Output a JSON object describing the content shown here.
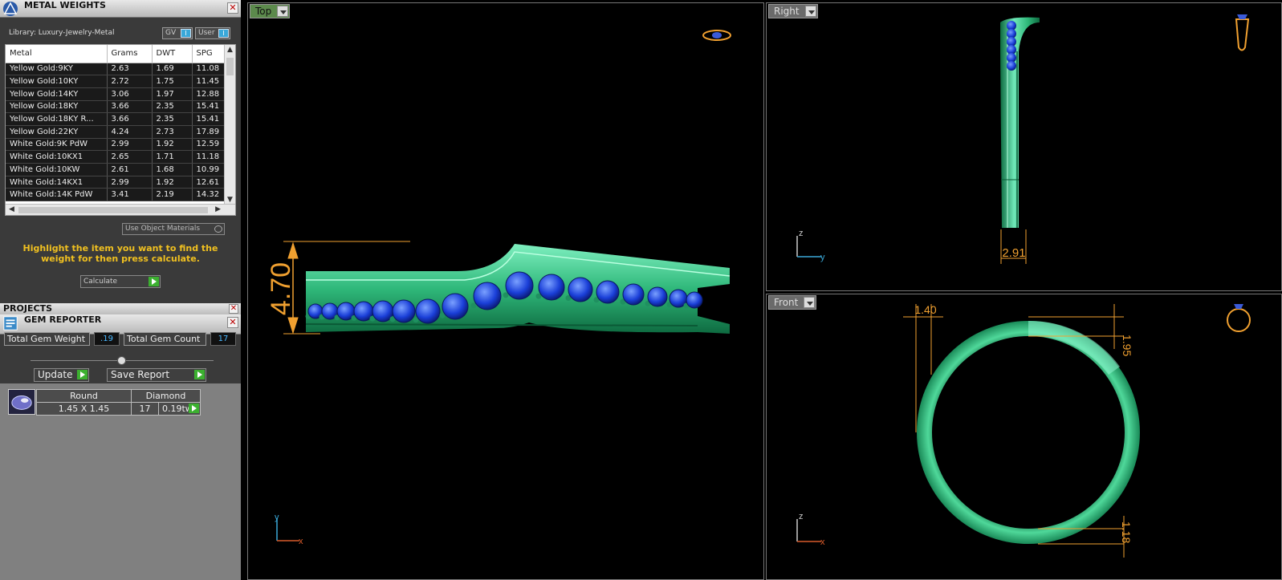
{
  "metal_weights": {
    "title": "METAL WEIGHTS",
    "library": "Library: Luxury-Jewelry-Metal",
    "toggle_gv": "GV",
    "toggle_user": "User",
    "columns": [
      "Metal",
      "Grams",
      "DWT",
      "SPG"
    ],
    "rows": [
      [
        "Yellow Gold:9KY",
        "2.63",
        "1.69",
        "11.08"
      ],
      [
        "Yellow Gold:10KY",
        "2.72",
        "1.75",
        "11.45"
      ],
      [
        "Yellow Gold:14KY",
        "3.06",
        "1.97",
        "12.88"
      ],
      [
        "Yellow Gold:18KY",
        "3.66",
        "2.35",
        "15.41"
      ],
      [
        "Yellow Gold:18KY R...",
        "3.66",
        "2.35",
        "15.41"
      ],
      [
        "Yellow Gold:22KY",
        "4.24",
        "2.73",
        "17.89"
      ],
      [
        "White Gold:9K PdW",
        "2.99",
        "1.92",
        "12.59"
      ],
      [
        "White Gold:10KX1",
        "2.65",
        "1.71",
        "11.18"
      ],
      [
        "White Gold:10KW",
        "2.61",
        "1.68",
        "10.99"
      ],
      [
        "White Gold:14KX1",
        "2.99",
        "1.92",
        "12.61"
      ],
      [
        "White Gold:14K PdW",
        "3.41",
        "2.19",
        "14.32"
      ]
    ],
    "use_object_materials": "Use Object Materials",
    "hint": "Highlight the item you want to find the weight for then press calculate.",
    "calculate": "Calculate"
  },
  "projects": {
    "title": "PROJECTS"
  },
  "gem_reporter": {
    "title": "GEM REPORTER",
    "total_weight_label": "Total Gem Weight",
    "total_weight_value": ".19",
    "total_count_label": "Total Gem Count",
    "total_count_value": "17",
    "update": "Update",
    "save_report": "Save Report",
    "gem": {
      "shape": "Round",
      "size": "1.45 X 1.45",
      "type": "Diamond",
      "count": "17",
      "weight": "0.19tw"
    }
  },
  "viewports": {
    "top": {
      "label": "Top",
      "dimension": "4.70",
      "axis_v": "y",
      "axis_h": "x"
    },
    "right": {
      "label": "Right",
      "dimension": "2.91",
      "axis_v": "z",
      "axis_h": "y"
    },
    "front": {
      "label": "Front",
      "dim_left": "1.40",
      "dim_top": "1.95",
      "dim_bottom": "1.18",
      "axis_v": "z",
      "axis_h": "x"
    }
  },
  "colors": {
    "metal": "#2fb87a",
    "gem": "#1a3fd8",
    "dimension": "#f0a030",
    "panel": "#3a3a3a"
  }
}
